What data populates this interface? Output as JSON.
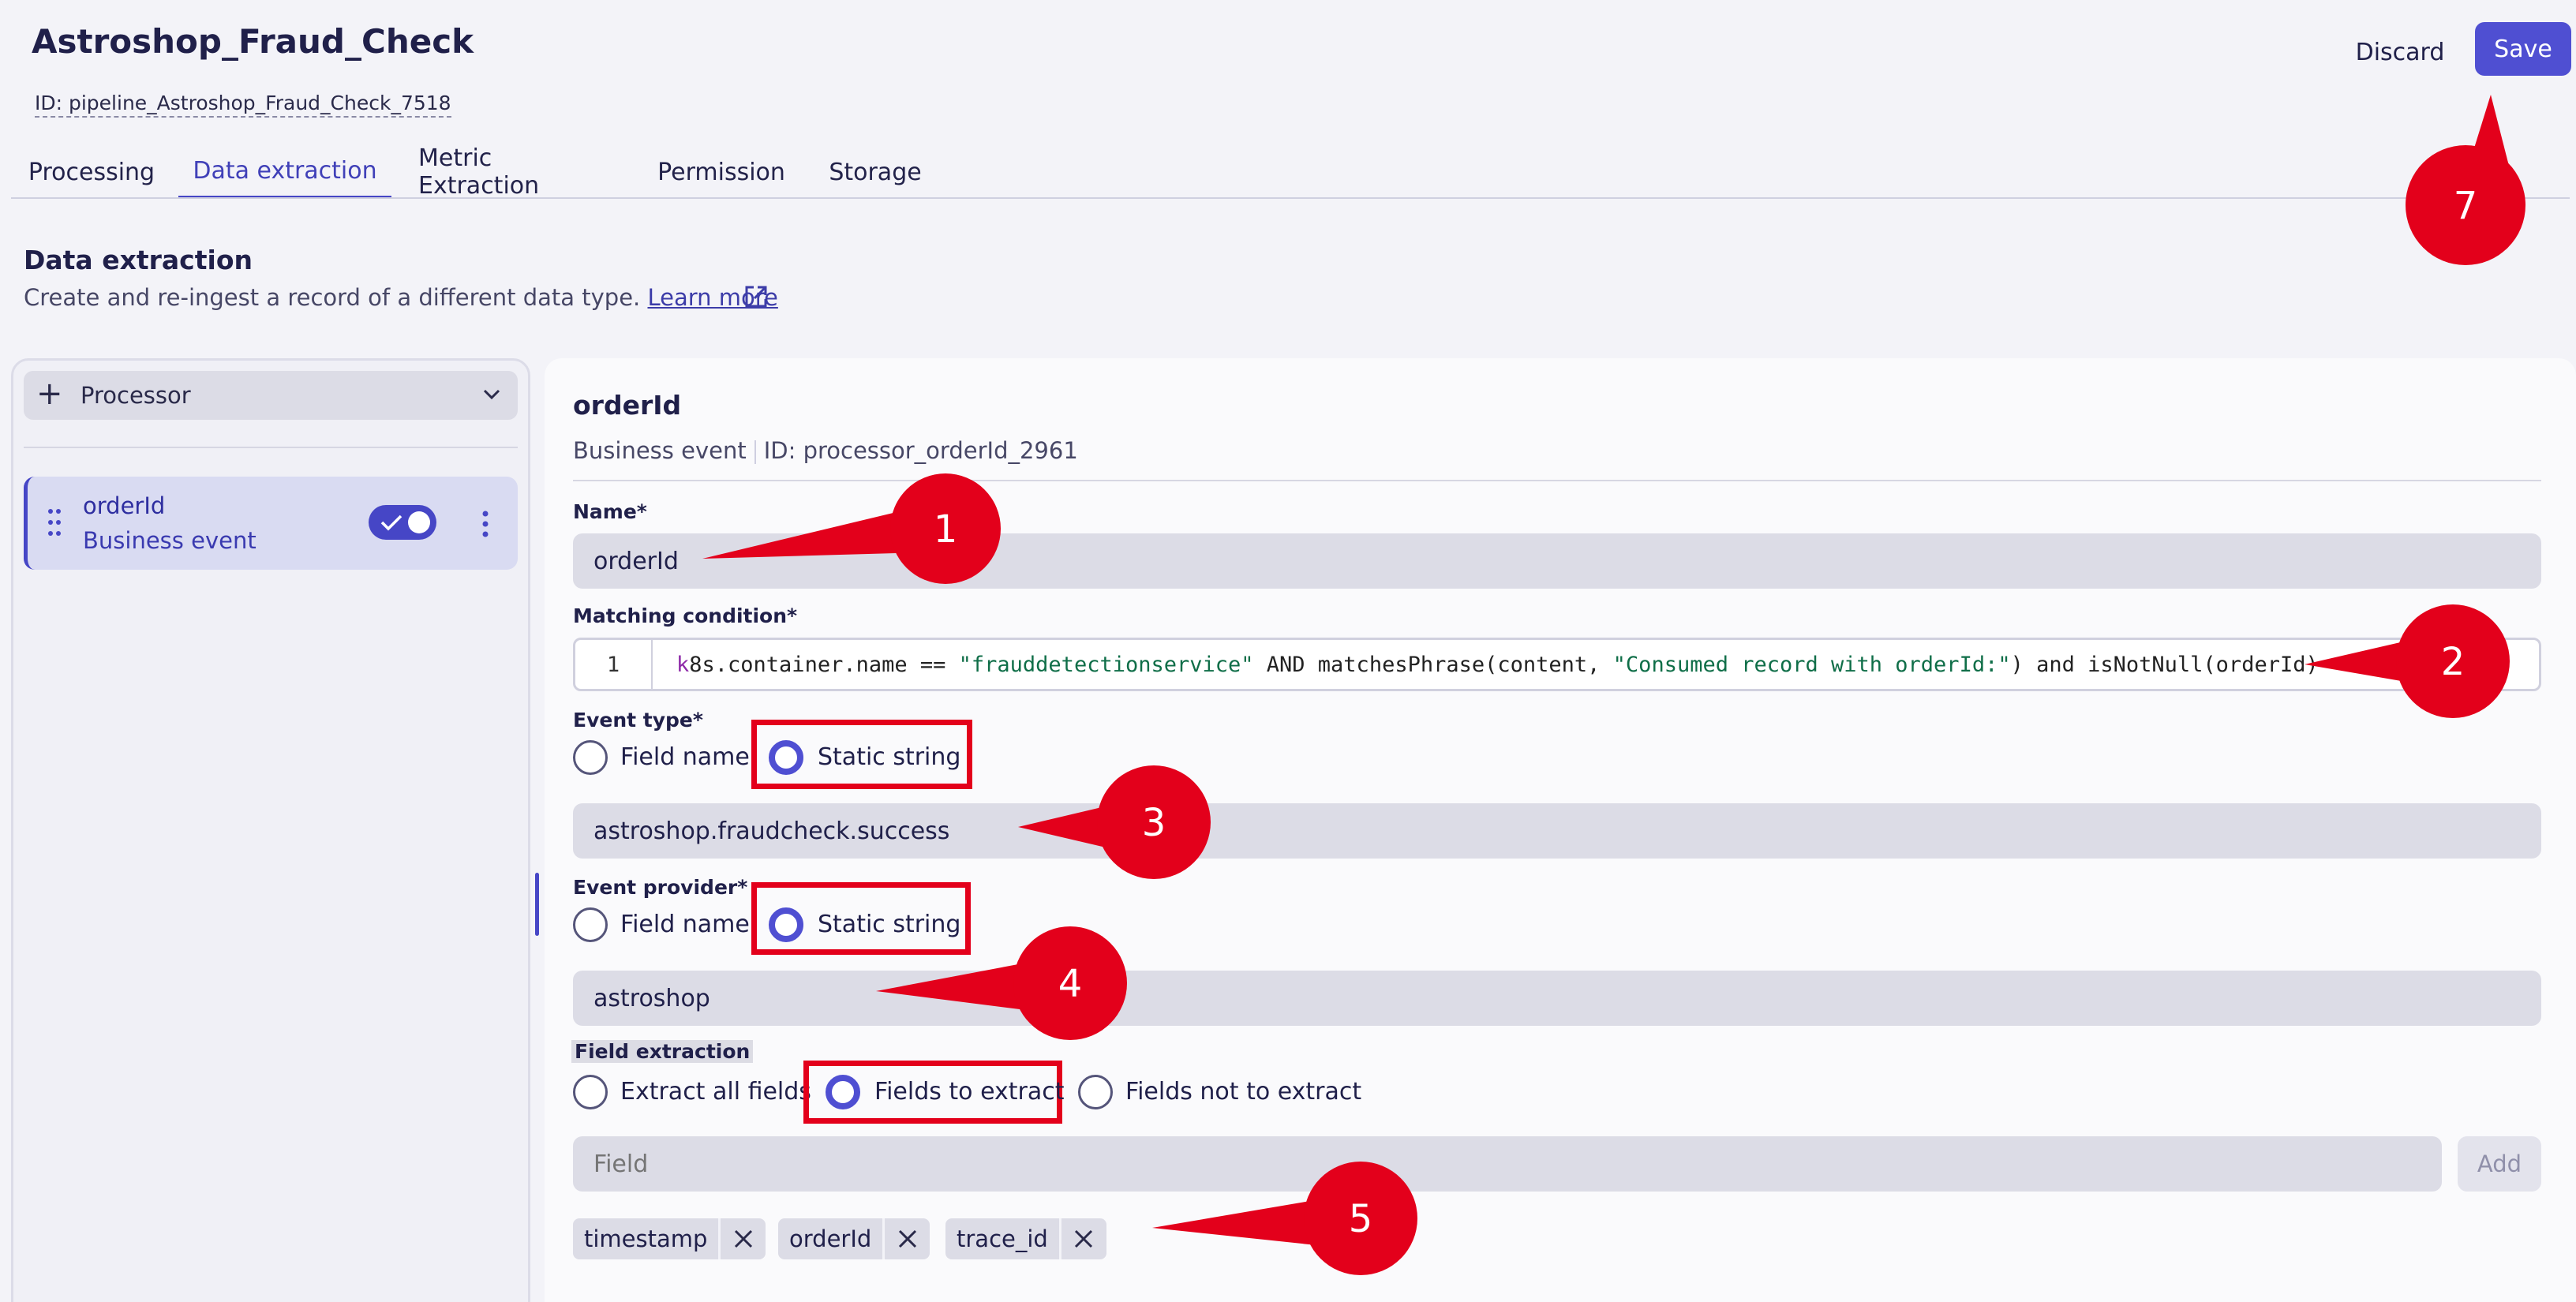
{
  "header": {
    "title": "Astroshop_Fraud_Check",
    "id_text": "ID: pipeline_Astroshop_Fraud_Check_7518",
    "discard_label": "Discard",
    "save_label": "Save"
  },
  "tabs": [
    {
      "label": "Processing"
    },
    {
      "label": "Data extraction"
    },
    {
      "label": "Metric Extraction"
    },
    {
      "label": "Permission"
    },
    {
      "label": "Storage"
    }
  ],
  "active_tab": "Data extraction",
  "section": {
    "title": "Data extraction",
    "description": "Create and re-ingest a record of a different data type.",
    "learn_more": "Learn more"
  },
  "sidebar": {
    "processor_dropdown": "Processor",
    "items": [
      {
        "name": "orderId",
        "type": "Business event",
        "enabled": true
      }
    ]
  },
  "processor": {
    "title": "orderId",
    "type": "Business event",
    "id_text": "ID: processor_orderId_2961",
    "name_label": "Name*",
    "name_value": "orderId",
    "matching_label": "Matching condition*",
    "line_number": "1",
    "code": {
      "p1": "k",
      "p2": "8s.container.name == ",
      "s1": "\"frauddetectionservice\"",
      "p3": " AND matchesPhrase(content, ",
      "s2": "\"Consumed record with orderId:\"",
      "p4": ") and isNotNull(orderId)"
    },
    "event_type_label": "Event type*",
    "event_type_options": {
      "field_name": "Field name",
      "static_string": "Static string"
    },
    "event_type_selected": "Static string",
    "event_type_value": "astroshop.fraudcheck.success",
    "event_provider_label": "Event provider*",
    "event_provider_options": {
      "field_name": "Field name",
      "static_string": "Static string"
    },
    "event_provider_selected": "Static string",
    "event_provider_value": "astroshop",
    "field_extraction_label": "Field extraction",
    "field_extraction_options": {
      "all": "Extract all fields",
      "to_extract": "Fields to extract",
      "not_to_extract": "Fields not to extract"
    },
    "field_extraction_selected": "Fields to extract",
    "field_placeholder": "Field",
    "add_label": "Add",
    "fields": [
      "timestamp",
      "orderId",
      "trace_id"
    ]
  },
  "callouts": [
    "1",
    "2",
    "3",
    "4",
    "5",
    "7"
  ],
  "colors": {
    "accent": "#4f4fd2",
    "callout_red": "#e3001b",
    "page_bg": "#f3f3f8"
  }
}
